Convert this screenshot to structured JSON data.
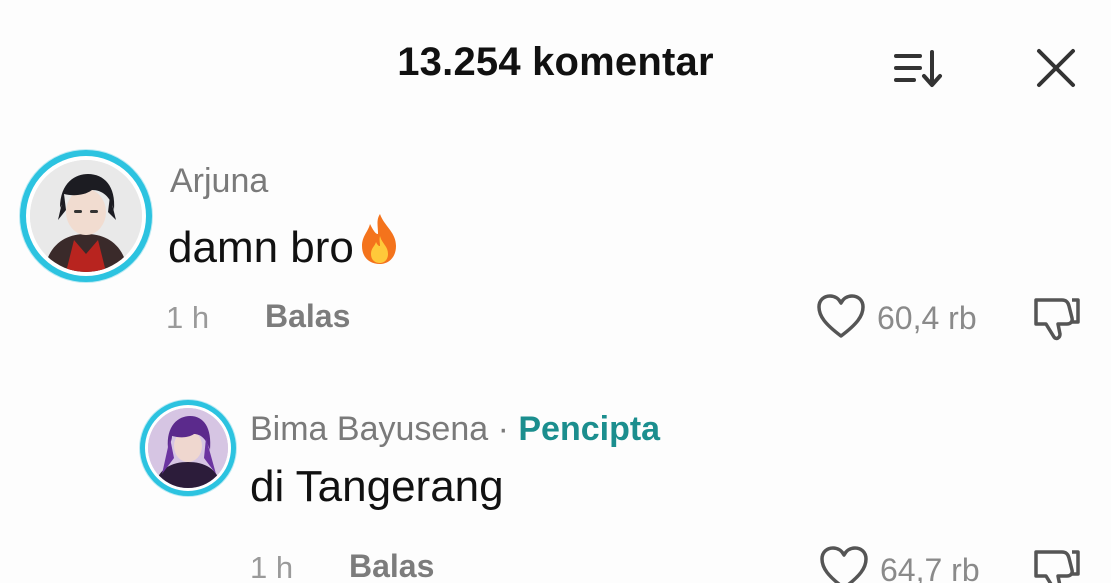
{
  "header": {
    "title": "13.254 komentar",
    "sort_icon": "sort-list-icon",
    "close_icon": "close-icon"
  },
  "comments": [
    {
      "username": "Arjuna",
      "text": "damn bro",
      "emoji": "🔥",
      "time": "1 h",
      "reply_label": "Balas",
      "likes": "60,4 rb",
      "is_creator": false
    },
    {
      "username": "Bima Bayusena",
      "separator": "·",
      "creator_label": "Pencipta",
      "text": "di Tangerang",
      "time": "1 h",
      "reply_label": "Balas",
      "likes": "64,7 rb",
      "is_creator": true
    }
  ],
  "colors": {
    "avatar_ring": "#2cc3e0",
    "creator_label": "#1b8e8e",
    "muted_text": "#7a7a7a",
    "primary_text": "#111111"
  }
}
